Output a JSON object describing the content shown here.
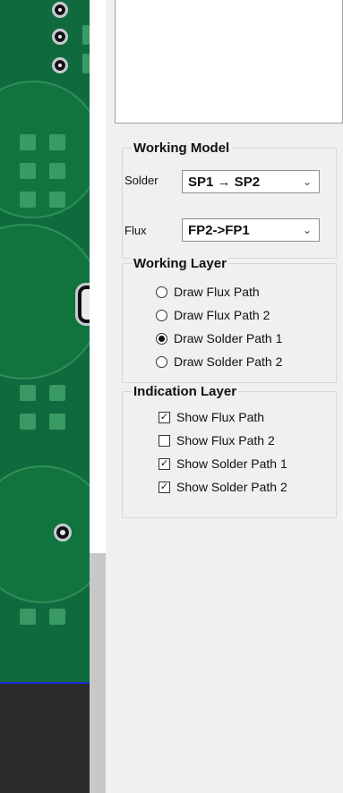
{
  "working_model": {
    "title": "Working Model",
    "solder_label": "Solder",
    "solder_value": "SP1 → SP2",
    "flux_label": "Flux",
    "flux_value": "FP2->FP1"
  },
  "working_layer": {
    "title": "Working Layer",
    "options": [
      {
        "label": "Draw Flux Path",
        "selected": false
      },
      {
        "label": "Draw Flux Path 2",
        "selected": false
      },
      {
        "label": "Draw Solder Path 1",
        "selected": true
      },
      {
        "label": "Draw Solder Path 2",
        "selected": false
      }
    ]
  },
  "indication_layer": {
    "title": "Indication Layer",
    "options": [
      {
        "label": "Show Flux Path",
        "checked": true
      },
      {
        "label": "Show Flux Path 2",
        "checked": false
      },
      {
        "label": "Show Solder Path 1",
        "checked": true
      },
      {
        "label": "Show Solder Path 2",
        "checked": true
      }
    ]
  },
  "icons": {
    "chevron": "chevron-down-icon",
    "check": "check-icon"
  },
  "colors": {
    "pcb_green": "#0f6b3d",
    "pcb_pad": "#3a9a63",
    "blue_line": "#1a2bd6",
    "panel_bg": "#f0f0f0"
  }
}
